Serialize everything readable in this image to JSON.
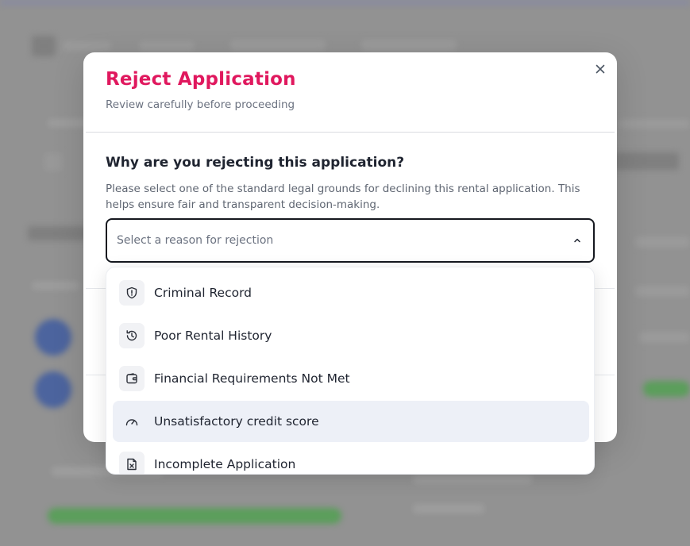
{
  "dialog": {
    "title": "Reject Application",
    "subtitle": "Review carefully before proceeding",
    "question": "Why are you rejecting this application?",
    "help_text": "Please select one of the standard legal grounds for declining this rental application. This helps ensure fair and transparent decision-making.",
    "close_icon": "close-icon"
  },
  "reason_select": {
    "placeholder": "Select a reason for rejection",
    "state": "open",
    "chevron_icon": "chevron-up-icon"
  },
  "reason_options": [
    {
      "label": "Criminal Record",
      "icon": "shield-alert-icon"
    },
    {
      "label": "Poor Rental History",
      "icon": "history-icon"
    },
    {
      "label": "Financial Requirements Not Met",
      "icon": "wallet-icon"
    },
    {
      "label": "Unsatisfactory credit score",
      "icon": "gauge-icon",
      "highlighted": true
    },
    {
      "label": "Incomplete Application",
      "icon": "file-x-icon"
    }
  ],
  "colors": {
    "title": "#e0185e",
    "highlight_bg": "#edf0f7",
    "select_border": "#15181f"
  }
}
